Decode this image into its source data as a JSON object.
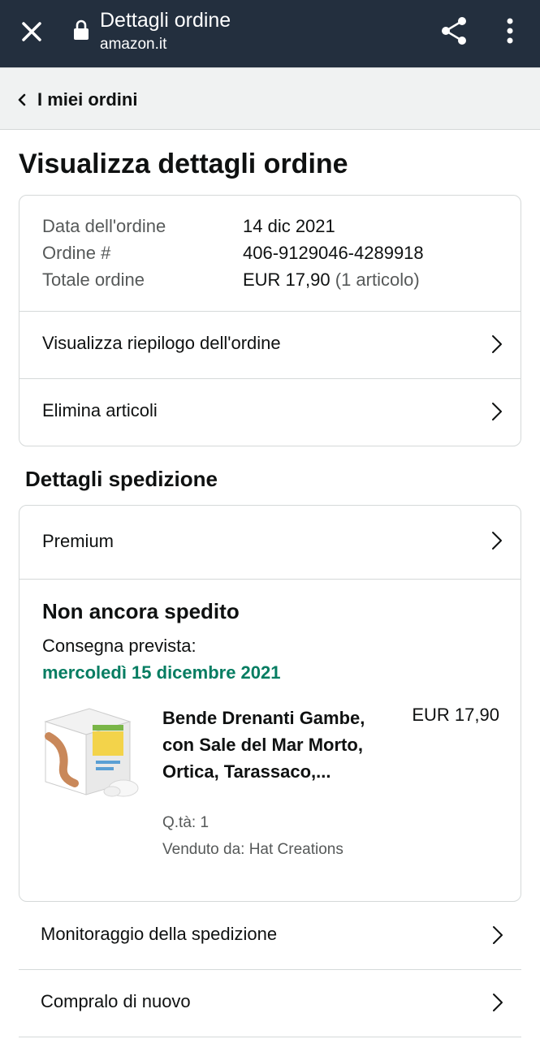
{
  "browser": {
    "title": "Dettagli ordine",
    "domain": "amazon.it",
    "icons": [
      "close-icon",
      "lock-icon",
      "share-icon",
      "more-vert-icon"
    ]
  },
  "nav": {
    "back_label": "I miei ordini"
  },
  "page": {
    "title": "Visualizza dettagli ordine"
  },
  "order": {
    "date_label": "Data dell'ordine",
    "date_value": "14 dic 2021",
    "number_label": "Ordine #",
    "number_value": "406-9129046-4289918",
    "total_label": "Totale ordine",
    "total_value": "EUR 17,90",
    "total_items": "(1 articolo)",
    "links": [
      "Visualizza riepilogo dell'ordine",
      "Elimina articoli"
    ]
  },
  "shipping": {
    "section_title": "Dettagli spedizione",
    "service": "Premium",
    "status": "Non ancora spedito",
    "delivery_label": "Consegna prevista:",
    "delivery_date": "mercoledì 15 dicembre 2021",
    "delivery_color": "#067d62",
    "item": {
      "title": "Bende Drenanti Gambe, con Sale del Mar Morto, Ortica, Tarassaco,...",
      "price": "EUR 17,90",
      "quantity": "Q.tà: 1",
      "seller": "Venduto da: Hat Creations"
    }
  },
  "actions": [
    "Monitoraggio della spedizione",
    "Compralo di nuovo"
  ],
  "colors": {
    "header_bg": "#232f3e",
    "backbar_bg": "#f0f2f2",
    "border": "#d5d9d9"
  }
}
